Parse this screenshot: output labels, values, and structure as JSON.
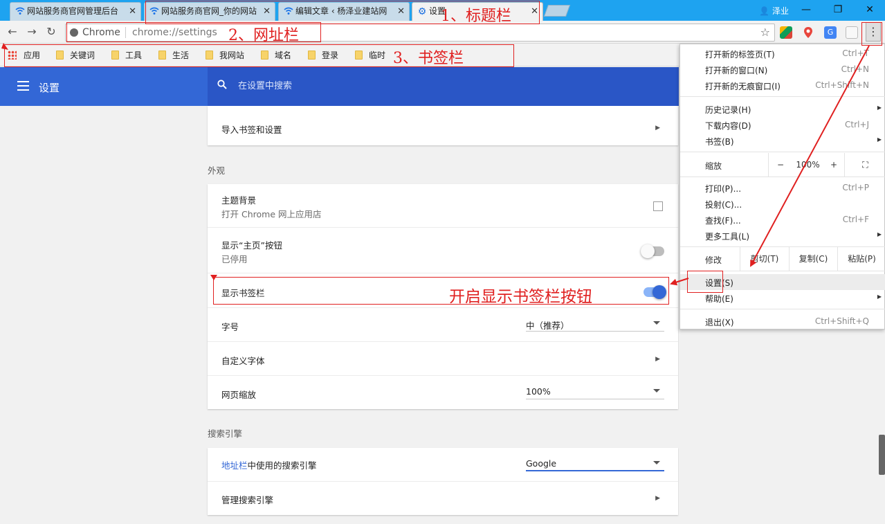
{
  "tabs": [
    {
      "title": "网站服务商官网管理后台",
      "icon": "wifi-icon"
    },
    {
      "title": "网站服务商官网_你的网站",
      "icon": "wifi-icon"
    },
    {
      "title": "编辑文章 ‹ 杨泽业建站网",
      "icon": "wifi-icon"
    },
    {
      "title": "设置",
      "icon": "gear-icon"
    }
  ],
  "window": {
    "user_name": "泽业"
  },
  "omnibox": {
    "chrome_label": "Chrome",
    "url": "chrome://settings"
  },
  "bookmarks": [
    "应用",
    "关键词",
    "工具",
    "生活",
    "我网站",
    "域名",
    "登录",
    "临时"
  ],
  "settings": {
    "header_title": "设置",
    "search_placeholder": "在设置中搜索",
    "import_row": "导入书签和设置",
    "appearance_title": "外观",
    "theme_label": "主题背景",
    "theme_sub": "打开 Chrome 网上应用店",
    "home_button_label": "显示“主页”按钮",
    "home_button_sub": "已停用",
    "home_button_on": false,
    "bookmarks_bar_label": "显示书签栏",
    "bookmarks_bar_on": true,
    "font_size_label": "字号",
    "font_size_value": "中（推荐）",
    "custom_fonts_label": "自定义字体",
    "page_zoom_label": "网页缩放",
    "page_zoom_value": "100%",
    "search_engine_title": "搜索引擎",
    "search_engine_label_link": "地址栏",
    "search_engine_label_rest": "中使用的搜索引擎",
    "search_engine_value": "Google",
    "manage_search_label": "管理搜索引擎"
  },
  "menu": {
    "new_tab": {
      "label": "打开新的标签页(T)",
      "shortcut": "Ctrl+T"
    },
    "new_window": {
      "label": "打开新的窗口(N)",
      "shortcut": "Ctrl+N"
    },
    "incognito": {
      "label": "打开新的无痕窗口(I)",
      "shortcut": "Ctrl+Shift+N"
    },
    "history": {
      "label": "历史记录(H)"
    },
    "downloads": {
      "label": "下载内容(D)",
      "shortcut": "Ctrl+J"
    },
    "bookmarks": {
      "label": "书签(B)"
    },
    "zoom": {
      "label": "缩放",
      "minus": "−",
      "value": "100%",
      "plus": "+"
    },
    "print": {
      "label": "打印(P)...",
      "shortcut": "Ctrl+P"
    },
    "cast": {
      "label": "投射(C)..."
    },
    "find": {
      "label": "查找(F)...",
      "shortcut": "Ctrl+F"
    },
    "more_tools": {
      "label": "更多工具(L)"
    },
    "edit": {
      "label": "修改",
      "cut": "剪切(T)",
      "copy": "复制(C)",
      "paste": "粘贴(P)"
    },
    "settings": {
      "label": "设置(S)"
    },
    "help": {
      "label": "帮助(E)"
    },
    "exit": {
      "label": "退出(X)",
      "shortcut": "Ctrl+Shift+Q"
    }
  },
  "annotations": {
    "title_bar": "1、标题栏",
    "address_bar": "2、网址栏",
    "bookmark_bar": "3、书签栏",
    "toggle_note": "开启显示书签栏按钮"
  },
  "colors": {
    "accent": "#3367d6",
    "annotation": "#e02020",
    "title_bar": "#1ea3f0"
  }
}
